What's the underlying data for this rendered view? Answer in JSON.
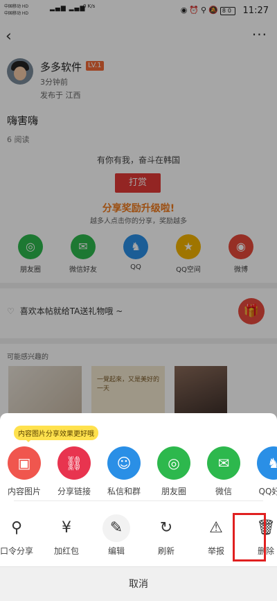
{
  "status_bar": {
    "carrier1": "中国移动 HD",
    "carrier2": "中国移动 HD",
    "speed": "0 K/s",
    "battery": "80",
    "time": "11:27"
  },
  "post": {
    "username": "多多软件",
    "level": "LV.1",
    "time_ago": "3分钟前",
    "location": "发布于 江西",
    "title": "嗨害嗨",
    "read_count": "6 阅读",
    "tagline": "有你有我，奋斗在韩国",
    "reward_label": "打赏",
    "share_title": "分享奖励升级啦!",
    "share_subtitle": "越多人点击你的分享，奖励越多"
  },
  "share_targets": [
    {
      "label": "朋友圈",
      "color": "#2db84d"
    },
    {
      "label": "微信好友",
      "color": "#2db84d"
    },
    {
      "label": "QQ",
      "color": "#2a8fe6"
    },
    {
      "label": "QQ空间",
      "color": "#f5b400"
    },
    {
      "label": "微博",
      "color": "#e6493a"
    }
  ],
  "gift_text": "喜欢本帖就给TA送礼物哦 ~",
  "maybe_like_label": "可能感兴趣的",
  "thumbnail_text": "一覺起來，又是美好的一天",
  "sheet": {
    "tip": "内容图片分享效果更好哦",
    "options": [
      {
        "label": "内容图片",
        "color": "#f0564e",
        "icon": "image-icon"
      },
      {
        "label": "分享链接",
        "color": "#e8344f",
        "icon": "link-icon"
      },
      {
        "label": "私信和群",
        "color": "#2a8fe6",
        "icon": "chat-icon"
      },
      {
        "label": "朋友圈",
        "color": "#2db84d",
        "icon": "moments-icon"
      },
      {
        "label": "微信",
        "color": "#2db84d",
        "icon": "wechat-icon"
      },
      {
        "label": "QQ好友",
        "color": "#2a8fe6",
        "icon": "qq-icon"
      }
    ],
    "actions": [
      {
        "label": "口令分享",
        "icon": "key-icon"
      },
      {
        "label": "加红包",
        "icon": "redpacket-icon"
      },
      {
        "label": "编辑",
        "icon": "edit-icon"
      },
      {
        "label": "刷新",
        "icon": "refresh-icon"
      },
      {
        "label": "举报",
        "icon": "warning-icon"
      },
      {
        "label": "删除",
        "icon": "trash-icon"
      }
    ],
    "cancel": "取消"
  }
}
